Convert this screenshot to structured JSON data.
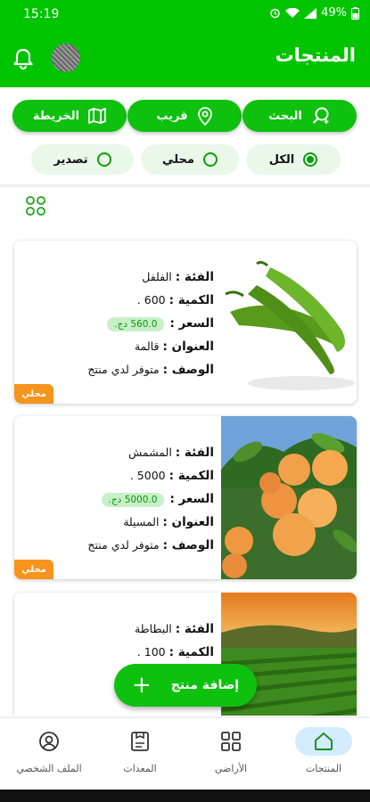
{
  "status_bar": {
    "time": "15:19",
    "battery": "49%"
  },
  "app_bar": {
    "title": "المنتجات",
    "icons": [
      "bell-icon",
      "avatar"
    ]
  },
  "actions": {
    "search": "البحث",
    "nearby": "قريب",
    "map": "الخريطة"
  },
  "filters": {
    "all": "الكل",
    "local": "محلي",
    "export": "تصدير",
    "selected": "الكل"
  },
  "labels": {
    "category": "الفئة :",
    "quantity": "الكمية :",
    "price": "السعر :",
    "address": "العنوان :",
    "description": "الوصف :"
  },
  "products": [
    {
      "category": "الفلفل",
      "quantity": "600 .",
      "price": "560.0 دج.",
      "address": "قالمة",
      "description": "متوفر لدي منتج",
      "badge": "محلي",
      "image": "green-peppers"
    },
    {
      "category": "المشمش",
      "quantity": "5000 .",
      "price": "5000.0 دج.",
      "address": "المسيلة",
      "description": "متوفر لدي منتج",
      "badge": "محلي",
      "image": "apricots"
    },
    {
      "category": "البطاطة",
      "quantity": "100 .",
      "image": "potato-field"
    }
  ],
  "fab": {
    "label": "إضافة منتج",
    "icon": "+"
  },
  "bottom_nav": {
    "products": "المنتجات",
    "lands": "الأراضي",
    "equipment": "المعدات",
    "profile": "الملف الشخصي",
    "active": "المنتجات"
  },
  "colors": {
    "primary": "#00c400",
    "badge": "#f7941d",
    "price_bg": "#c8f0c8",
    "active_nav": "#d4ecff"
  }
}
